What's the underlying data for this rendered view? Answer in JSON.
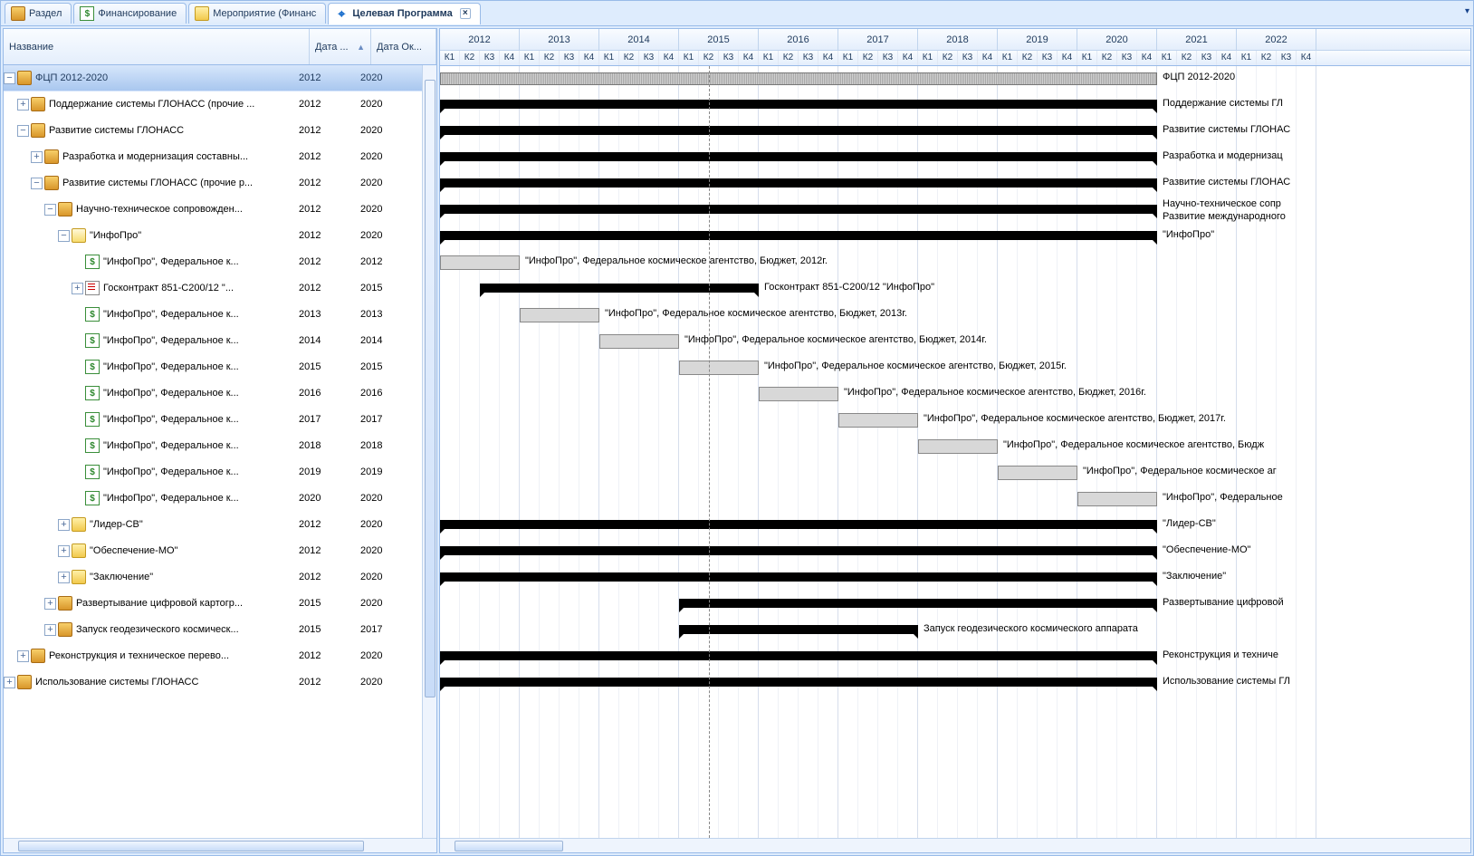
{
  "tabs": [
    {
      "label": "Раздел",
      "icon": "box"
    },
    {
      "label": "Финансирование",
      "icon": "dollar"
    },
    {
      "label": "Мероприятие (Финанс",
      "icon": "folder"
    },
    {
      "label": "Целевая Программа",
      "icon": "target",
      "active": true,
      "closable": true
    }
  ],
  "columns": {
    "name": "Название",
    "start": "Дата ...",
    "end": "Дата Ок..."
  },
  "years": [
    "2012",
    "2013",
    "2014",
    "2015",
    "2016",
    "2017",
    "2018",
    "2019",
    "2020",
    "2021",
    "2022"
  ],
  "quarters": [
    "К1",
    "К2",
    "К3",
    "К4"
  ],
  "todayYear": 2015,
  "todayQuarter": 2,
  "rows": [
    {
      "level": 0,
      "icon": "box",
      "expander": "-",
      "label": "ФЦП 2012-2020",
      "start": "2012",
      "end": "2020",
      "selected": true,
      "bar": {
        "type": "stripe",
        "from": 0,
        "to": 35
      },
      "rlabel": "ФЦП 2012-2020"
    },
    {
      "level": 1,
      "icon": "box",
      "expander": "+",
      "label": "Поддержание системы ГЛОНАСС (прочие ...",
      "start": "2012",
      "end": "2020",
      "bar": {
        "type": "group",
        "from": 0,
        "to": 35
      },
      "rlabel": "Поддержание системы ГЛ"
    },
    {
      "level": 1,
      "icon": "box",
      "expander": "-",
      "label": "Развитие системы ГЛОНАСС",
      "start": "2012",
      "end": "2020",
      "bar": {
        "type": "group",
        "from": 0,
        "to": 35
      },
      "rlabel": "Развитие системы ГЛОНАС"
    },
    {
      "level": 2,
      "icon": "box",
      "expander": "+",
      "label": "Разработка и модернизация составны...",
      "start": "2012",
      "end": "2020",
      "bar": {
        "type": "group",
        "from": 0,
        "to": 35
      },
      "rlabel": "Разработка и модернизац"
    },
    {
      "level": 2,
      "icon": "box",
      "expander": "-",
      "label": "Развитие системы ГЛОНАСС (прочие р...",
      "start": "2012",
      "end": "2020",
      "bar": {
        "type": "group",
        "from": 0,
        "to": 35
      },
      "rlabel": "Развитие системы ГЛОНАС"
    },
    {
      "level": 3,
      "icon": "box",
      "expander": "-",
      "label": "Научно-техническое сопровожден...",
      "start": "2012",
      "end": "2020",
      "bar": {
        "type": "group",
        "from": 0,
        "to": 35
      },
      "rlabel": "Научно-техническое сопр\nРазвитие международного"
    },
    {
      "level": 4,
      "icon": "folder-open",
      "expander": "-",
      "label": "\"ИнфоПро\"",
      "start": "2012",
      "end": "2020",
      "bar": {
        "type": "group",
        "from": 0,
        "to": 35
      },
      "rlabel": "\"ИнфоПро\""
    },
    {
      "level": 5,
      "icon": "dollar",
      "expander": "",
      "label": "\"ИнфоПро\", Федеральное к...",
      "start": "2012",
      "end": "2012",
      "bar": {
        "type": "task",
        "from": 0,
        "to": 3
      },
      "rlabel": "\"ИнфоПро\", Федеральное космическое агентство, Бюджет, 2012г."
    },
    {
      "level": 5,
      "icon": "doc",
      "expander": "+",
      "label": "Госконтракт 851-С200/12 \"...",
      "start": "2012",
      "end": "2015",
      "bar": {
        "type": "group",
        "from": 2,
        "to": 15
      },
      "rlabel": "Госконтракт 851-С200/12 \"ИнфоПро\""
    },
    {
      "level": 5,
      "icon": "dollar",
      "expander": "",
      "label": "\"ИнфоПро\", Федеральное к...",
      "start": "2013",
      "end": "2013",
      "bar": {
        "type": "task",
        "from": 4,
        "to": 7
      },
      "rlabel": "\"ИнфоПро\", Федеральное космическое агентство, Бюджет, 2013г."
    },
    {
      "level": 5,
      "icon": "dollar",
      "expander": "",
      "label": "\"ИнфоПро\", Федеральное к...",
      "start": "2014",
      "end": "2014",
      "bar": {
        "type": "task",
        "from": 8,
        "to": 11
      },
      "rlabel": "\"ИнфоПро\", Федеральное космическое агентство, Бюджет, 2014г."
    },
    {
      "level": 5,
      "icon": "dollar",
      "expander": "",
      "label": "\"ИнфоПро\", Федеральное к...",
      "start": "2015",
      "end": "2015",
      "bar": {
        "type": "task",
        "from": 12,
        "to": 15
      },
      "rlabel": "\"ИнфоПро\", Федеральное космическое агентство, Бюджет, 2015г."
    },
    {
      "level": 5,
      "icon": "dollar",
      "expander": "",
      "label": "\"ИнфоПро\", Федеральное к...",
      "start": "2016",
      "end": "2016",
      "bar": {
        "type": "task",
        "from": 16,
        "to": 19
      },
      "rlabel": "\"ИнфоПро\", Федеральное космическое агентство, Бюджет, 2016г."
    },
    {
      "level": 5,
      "icon": "dollar",
      "expander": "",
      "label": "\"ИнфоПро\", Федеральное к...",
      "start": "2017",
      "end": "2017",
      "bar": {
        "type": "task",
        "from": 20,
        "to": 23
      },
      "rlabel": "\"ИнфоПро\", Федеральное космическое агентство, Бюджет, 2017г."
    },
    {
      "level": 5,
      "icon": "dollar",
      "expander": "",
      "label": "\"ИнфоПро\", Федеральное к...",
      "start": "2018",
      "end": "2018",
      "bar": {
        "type": "task",
        "from": 24,
        "to": 27
      },
      "rlabel": "\"ИнфоПро\", Федеральное космическое агентство, Бюдж"
    },
    {
      "level": 5,
      "icon": "dollar",
      "expander": "",
      "label": "\"ИнфоПро\", Федеральное к...",
      "start": "2019",
      "end": "2019",
      "bar": {
        "type": "task",
        "from": 28,
        "to": 31
      },
      "rlabel": "\"ИнфоПро\", Федеральное космическое аг"
    },
    {
      "level": 5,
      "icon": "dollar",
      "expander": "",
      "label": "\"ИнфоПро\", Федеральное к...",
      "start": "2020",
      "end": "2020",
      "bar": {
        "type": "task",
        "from": 32,
        "to": 35
      },
      "rlabel": "\"ИнфоПро\", Федеральное"
    },
    {
      "level": 4,
      "icon": "folder",
      "expander": "+",
      "label": "\"Лидер-СВ\"",
      "start": "2012",
      "end": "2020",
      "bar": {
        "type": "group",
        "from": 0,
        "to": 35
      },
      "rlabel": "\"Лидер-СВ\""
    },
    {
      "level": 4,
      "icon": "folder",
      "expander": "+",
      "label": "\"Обеспечение-МО\"",
      "start": "2012",
      "end": "2020",
      "bar": {
        "type": "group",
        "from": 0,
        "to": 35
      },
      "rlabel": "\"Обеспечение-МО\""
    },
    {
      "level": 4,
      "icon": "folder",
      "expander": "+",
      "label": "\"Заключение\"",
      "start": "2012",
      "end": "2020",
      "bar": {
        "type": "group",
        "from": 0,
        "to": 35
      },
      "rlabel": "\"Заключение\""
    },
    {
      "level": 3,
      "icon": "box",
      "expander": "+",
      "label": "Развертывание цифровой картогр...",
      "start": "2015",
      "end": "2020",
      "bar": {
        "type": "group",
        "from": 12,
        "to": 35
      },
      "rlabel": "Развертывание цифровой"
    },
    {
      "level": 3,
      "icon": "box",
      "expander": "+",
      "label": "Запуск геодезического космическ...",
      "start": "2015",
      "end": "2017",
      "bar": {
        "type": "group",
        "from": 12,
        "to": 23
      },
      "rlabel": "Запуск геодезического космического аппарата"
    },
    {
      "level": 1,
      "icon": "box",
      "expander": "+",
      "label": "Реконструкция и техническое перево...",
      "start": "2012",
      "end": "2020",
      "bar": {
        "type": "group",
        "from": 0,
        "to": 35
      },
      "rlabel": "Реконструкция и техниче"
    },
    {
      "level": 0,
      "icon": "box",
      "expander": "+",
      "label": "Использование системы ГЛОНАСС",
      "start": "2012",
      "end": "2020",
      "bar": {
        "type": "group",
        "from": 0,
        "to": 35
      },
      "rlabel": "Использование системы ГЛ"
    }
  ]
}
